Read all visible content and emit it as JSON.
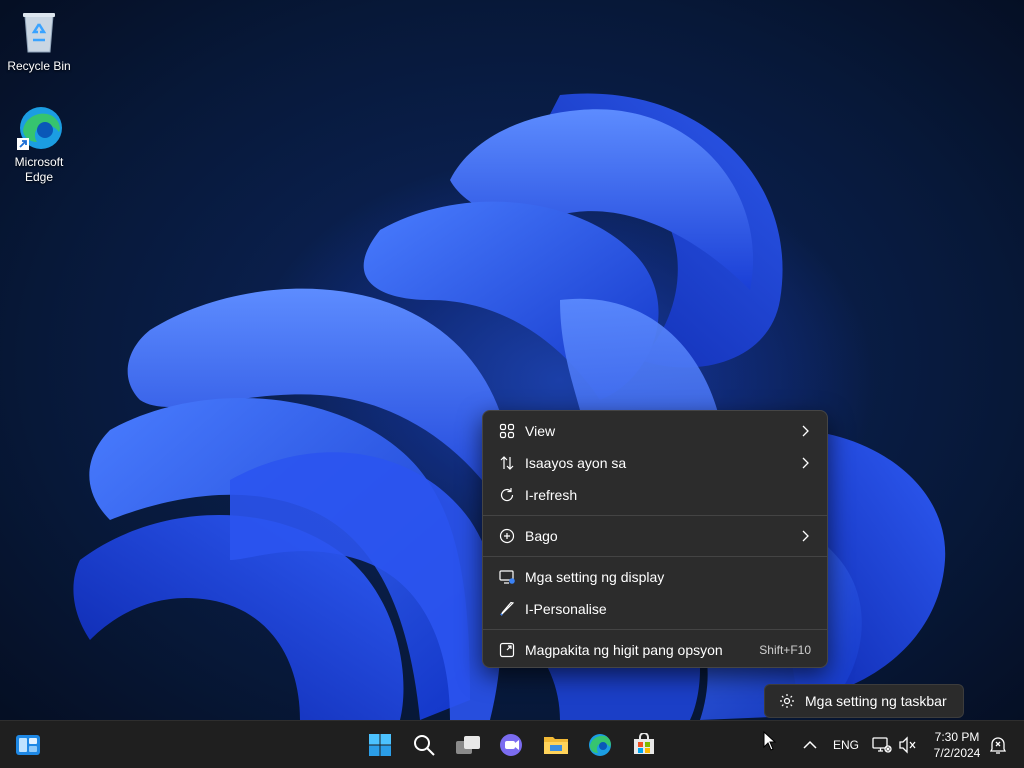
{
  "desktop": {
    "icons": [
      {
        "label": "Recycle Bin"
      },
      {
        "label_line1": "Microsoft",
        "label_line2": "Edge"
      }
    ]
  },
  "context_menu": {
    "items": [
      {
        "label": "View",
        "icon": "grid-icon",
        "submenu": true
      },
      {
        "label": "Isaayos ayon sa",
        "icon": "sort-icon",
        "submenu": true
      },
      {
        "label": "I-refresh",
        "icon": "refresh-icon"
      },
      {
        "label": "Bago",
        "icon": "plus-circle-icon",
        "submenu": true
      },
      {
        "label": "Mga setting ng display",
        "icon": "display-settings-icon"
      },
      {
        "label": "I-Personalise",
        "icon": "brush-icon"
      },
      {
        "label": "Magpakita ng higit pang opsyon",
        "icon": "expand-icon",
        "shortcut": "Shift+F10"
      }
    ]
  },
  "tooltip": {
    "label": "Mga setting ng taskbar"
  },
  "taskbar": {
    "apps": [
      "widgets-icon",
      "start-icon",
      "search-icon",
      "task-view-icon",
      "chat-icon",
      "file-explorer-icon",
      "edge-icon",
      "store-icon"
    ],
    "tray": {
      "language": "ENG",
      "time": "7:30 PM",
      "date": "7/2/2024"
    }
  },
  "colors": {
    "accent": "#3b82f6",
    "menu_bg": "#2c2c2c",
    "taskbar_bg": "#1f1f1f"
  }
}
